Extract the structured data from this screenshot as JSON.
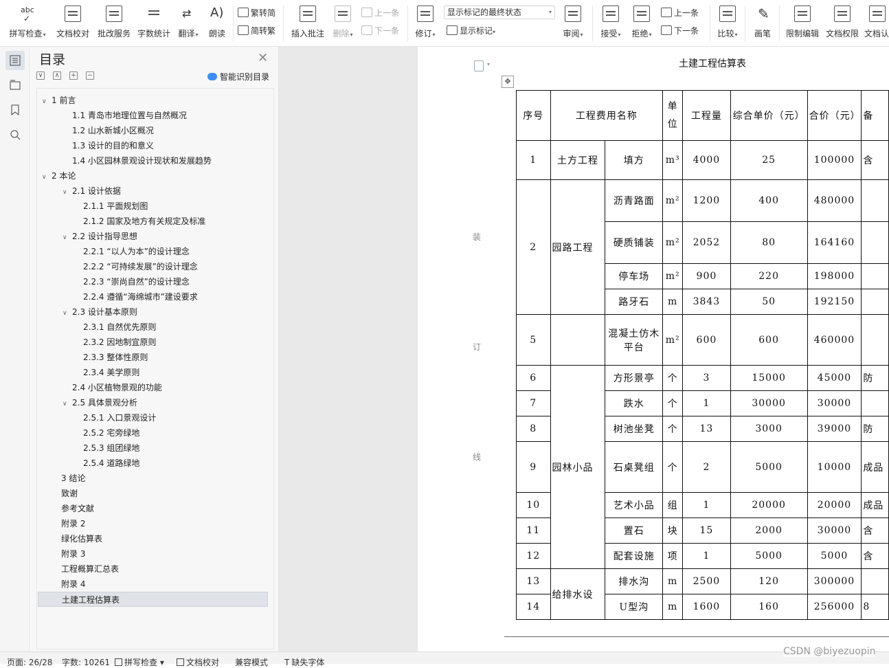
{
  "toolbar": {
    "spell": "拼写检查",
    "doc_proof": "文档校对",
    "review_service": "批改服务",
    "word_count": "字数统计",
    "translate": "翻译",
    "read_aloud": "朗读",
    "trad_to_simp": "繁转简",
    "simp_to_trad": "简转繁",
    "insert_comment": "插入批注",
    "delete": "删除",
    "prev_comment": "上一条",
    "next_comment": "下一条",
    "revise": "修订",
    "markup_state": "显示标记的最终状态",
    "show_markup": "显示标记",
    "review": "审阅",
    "accept": "接受",
    "reject": "拒绝",
    "prev_change": "上一条",
    "next_change": "下一条",
    "compare": "比较",
    "pen": "画笔",
    "restrict_edit": "限制编辑",
    "doc_permission": "文档权限",
    "doc_auth": "文档认"
  },
  "panel": {
    "title": "目录",
    "smart_label": "智能识别目录",
    "items": [
      {
        "label": "1 前言",
        "level": 0,
        "tw": "∨"
      },
      {
        "label": "1.1  青岛市地理位置与自然概况",
        "level": 1
      },
      {
        "label": "1.2  山水新城小区概况",
        "level": 1
      },
      {
        "label": "1.3 设计的目的和意义",
        "level": 1
      },
      {
        "label": "1.4 小区园林景观设计现状和发展趋势",
        "level": 1
      },
      {
        "label": "2 本论",
        "level": 0,
        "tw": "∨"
      },
      {
        "label": "2.1 设计依据",
        "level": 1,
        "tw": "∨"
      },
      {
        "label": "2.1.1  平面规划图",
        "level": 2
      },
      {
        "label": "2.1.2  国家及地方有关规定及标准",
        "level": 2
      },
      {
        "label": "2.2  设计指导思想",
        "level": 1,
        "tw": "∨"
      },
      {
        "label": "2.2.1  “以人为本”的设计理念",
        "level": 2
      },
      {
        "label": "2.2.2  “可持续发展”的设计理念",
        "level": 2
      },
      {
        "label": "2.2.3  “崇尚自然”的设计理念",
        "level": 2
      },
      {
        "label": "2.2.4  遵循“海绵城市”建设要求",
        "level": 2
      },
      {
        "label": "2.3  设计基本原则",
        "level": 1,
        "tw": "∨"
      },
      {
        "label": "2.3.1  自然优先原则",
        "level": 2
      },
      {
        "label": "2.3.2  因地制宜原则",
        "level": 2
      },
      {
        "label": "2.3.3  整体性原则",
        "level": 2
      },
      {
        "label": "2.3.4  美学原则",
        "level": 2
      },
      {
        "label": "2.4  小区植物景观的功能",
        "level": 1
      },
      {
        "label": "2.5 具体景观分析",
        "level": 1,
        "tw": "∨"
      },
      {
        "label": "2.5.1  入口景观设计",
        "level": 2
      },
      {
        "label": "2.5.2  宅旁绿地",
        "level": 2
      },
      {
        "label": "2.5.3  组团绿地",
        "level": 2
      },
      {
        "label": "2.5.4  道路绿地",
        "level": 2
      },
      {
        "label": "3 结论",
        "level": 3
      },
      {
        "label": "致谢",
        "level": 3
      },
      {
        "label": "参考文献",
        "level": 3
      },
      {
        "label": "附录 2",
        "level": 3
      },
      {
        "label": "绿化估算表",
        "level": 3
      },
      {
        "label": "附录 3",
        "level": 3
      },
      {
        "label": "工程概算汇总表",
        "level": 3
      },
      {
        "label": "附录 4",
        "level": 3
      },
      {
        "label": "土建工程估算表",
        "level": 3,
        "selected": true
      }
    ]
  },
  "document": {
    "title": "土建工程估算表",
    "margin_chars": [
      "装",
      "订",
      "线"
    ],
    "header": {
      "no": "序号",
      "name": "工程费用名称",
      "unit": "单位",
      "qty": "工程量",
      "unit_price": "综合单价（元）",
      "total": "合价（元）",
      "note": "备"
    },
    "rows": [
      {
        "no": "1",
        "cat": "土方工程",
        "item": "填方",
        "unit": "m³",
        "qty": "4000",
        "price": "25",
        "total": "100000",
        "note": "含"
      },
      {
        "no": "2",
        "cat": "园路工程",
        "item": "沥青路面",
        "unit": "m²",
        "qty": "1200",
        "price": "400",
        "total": "480000",
        "note": ""
      },
      {
        "no": "",
        "cat": "",
        "item": "硬质铺装",
        "unit": "m²",
        "qty": "2052",
        "price": "80",
        "total": "164160",
        "note": ""
      },
      {
        "no": "",
        "cat": "",
        "item": "停车场",
        "unit": "m²",
        "qty": "900",
        "price": "220",
        "total": "198000",
        "note": ""
      },
      {
        "no": "",
        "cat": "",
        "item": "路牙石",
        "unit": "m",
        "qty": "3843",
        "price": "50",
        "total": "192150",
        "note": ""
      },
      {
        "no": "5",
        "cat": "",
        "item": "混凝土仿木平台",
        "unit": "m²",
        "qty": "600",
        "price": "600",
        "total": "460000",
        "note": ""
      },
      {
        "no": "6",
        "cat": "园林小品",
        "item": "方形景亭",
        "unit": "个",
        "qty": "3",
        "price": "15000",
        "total": "45000",
        "note": "防"
      },
      {
        "no": "7",
        "cat": "",
        "item": "跌水",
        "unit": "个",
        "qty": "1",
        "price": "30000",
        "total": "30000",
        "note": ""
      },
      {
        "no": "8",
        "cat": "",
        "item": "树池坐凳",
        "unit": "个",
        "qty": "13",
        "price": "3000",
        "total": "39000",
        "note": "防"
      },
      {
        "no": "9",
        "cat": "",
        "item": "石桌凳组",
        "unit": "个",
        "qty": "2",
        "price": "5000",
        "total": "10000",
        "note": "成品"
      },
      {
        "no": "10",
        "cat": "",
        "item": "艺术小品",
        "unit": "组",
        "qty": "1",
        "price": "20000",
        "total": "20000",
        "note": "成品"
      },
      {
        "no": "11",
        "cat": "",
        "item": "置石",
        "unit": "块",
        "qty": "15",
        "price": "2000",
        "total": "30000",
        "note": "含"
      },
      {
        "no": "12",
        "cat": "",
        "item": "配套设施",
        "unit": "项",
        "qty": "1",
        "price": "5000",
        "total": "5000",
        "note": "含"
      },
      {
        "no": "13",
        "cat": "给排水设",
        "item": "排水沟",
        "unit": "m",
        "qty": "2500",
        "price": "120",
        "total": "300000",
        "note": ""
      },
      {
        "no": "14",
        "cat": "",
        "item": "U型沟",
        "unit": "m",
        "qty": "1600",
        "price": "160",
        "total": "256000",
        "note": "8"
      }
    ]
  },
  "status": {
    "page": "页面: 26/28",
    "words": "字数: 10261",
    "spell": "拼写检查",
    "proof": "文档校对",
    "compat": "兼容模式",
    "missing_font": "缺失字体"
  },
  "watermark": "CSDN @biyezuopin"
}
